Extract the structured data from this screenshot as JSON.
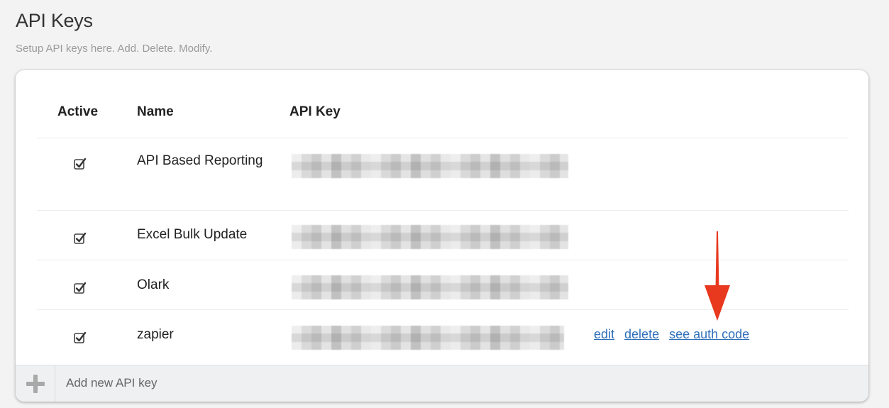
{
  "header": {
    "title": "API Keys",
    "subtitle": "Setup API keys here. Add. Delete. Modify."
  },
  "table": {
    "columns": [
      "Active",
      "Name",
      "API Key"
    ],
    "rows": [
      {
        "active": true,
        "name": "API Based Reporting",
        "api_key": "",
        "actions": []
      },
      {
        "active": true,
        "name": "Excel Bulk Update",
        "api_key": "",
        "actions": []
      },
      {
        "active": true,
        "name": "Olark",
        "api_key": "",
        "actions": []
      },
      {
        "active": true,
        "name": "zapier",
        "api_key": "",
        "actions": [
          "edit",
          "delete",
          "see auth code"
        ]
      }
    ]
  },
  "footer": {
    "add_label": "Add new API key",
    "icon": "plus-icon"
  },
  "colors": {
    "link": "#2f6fbb",
    "arrow": "#e8381e",
    "background": "#f3f3f3"
  }
}
